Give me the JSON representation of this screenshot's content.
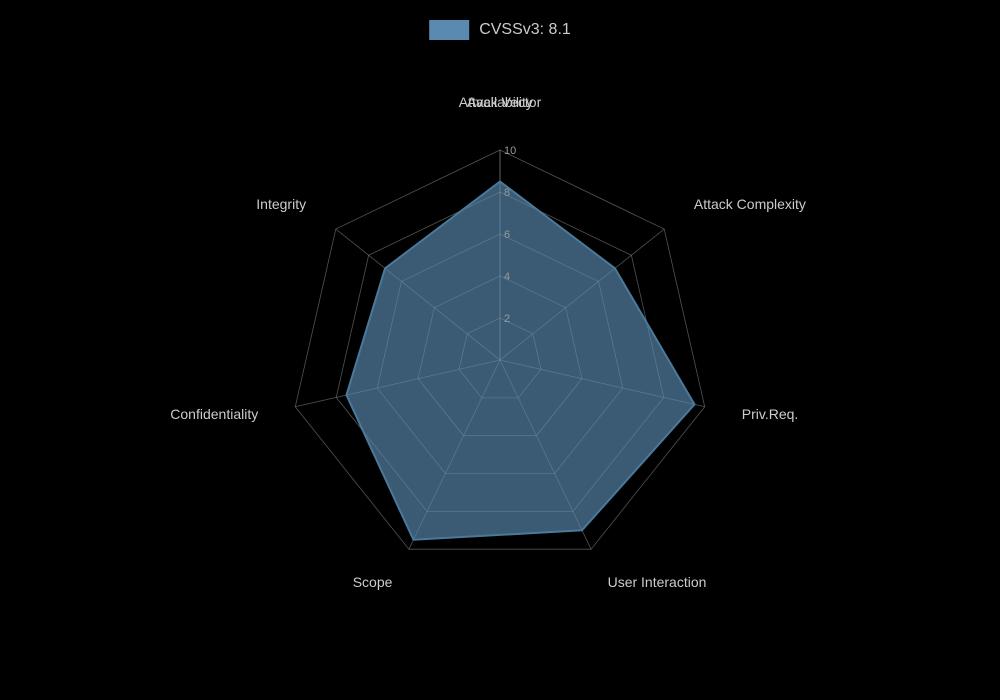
{
  "chart": {
    "title": "CVSSv3: 8.1",
    "legend_color": "#5b8ab0",
    "axes": [
      {
        "name": "Attack Vector",
        "angle": -90,
        "value": 8.5
      },
      {
        "name": "Attack Complexity",
        "angle": -38.57,
        "value": 7.0
      },
      {
        "name": "Priv.Req.",
        "angle": 12.86,
        "value": 9.5
      },
      {
        "name": "User Interaction",
        "angle": 64.29,
        "value": 9.0
      },
      {
        "name": "Scope",
        "angle": 115.71,
        "value": 9.5
      },
      {
        "name": "Confidentiality",
        "angle": 167.14,
        "value": 7.5
      },
      {
        "name": "Integrity",
        "angle": 218.57,
        "value": 7.0
      },
      {
        "name": "Availability",
        "angle": 270.0,
        "value": 8.5
      }
    ],
    "grid_levels": [
      2,
      4,
      6,
      8,
      10
    ],
    "max_value": 10
  }
}
